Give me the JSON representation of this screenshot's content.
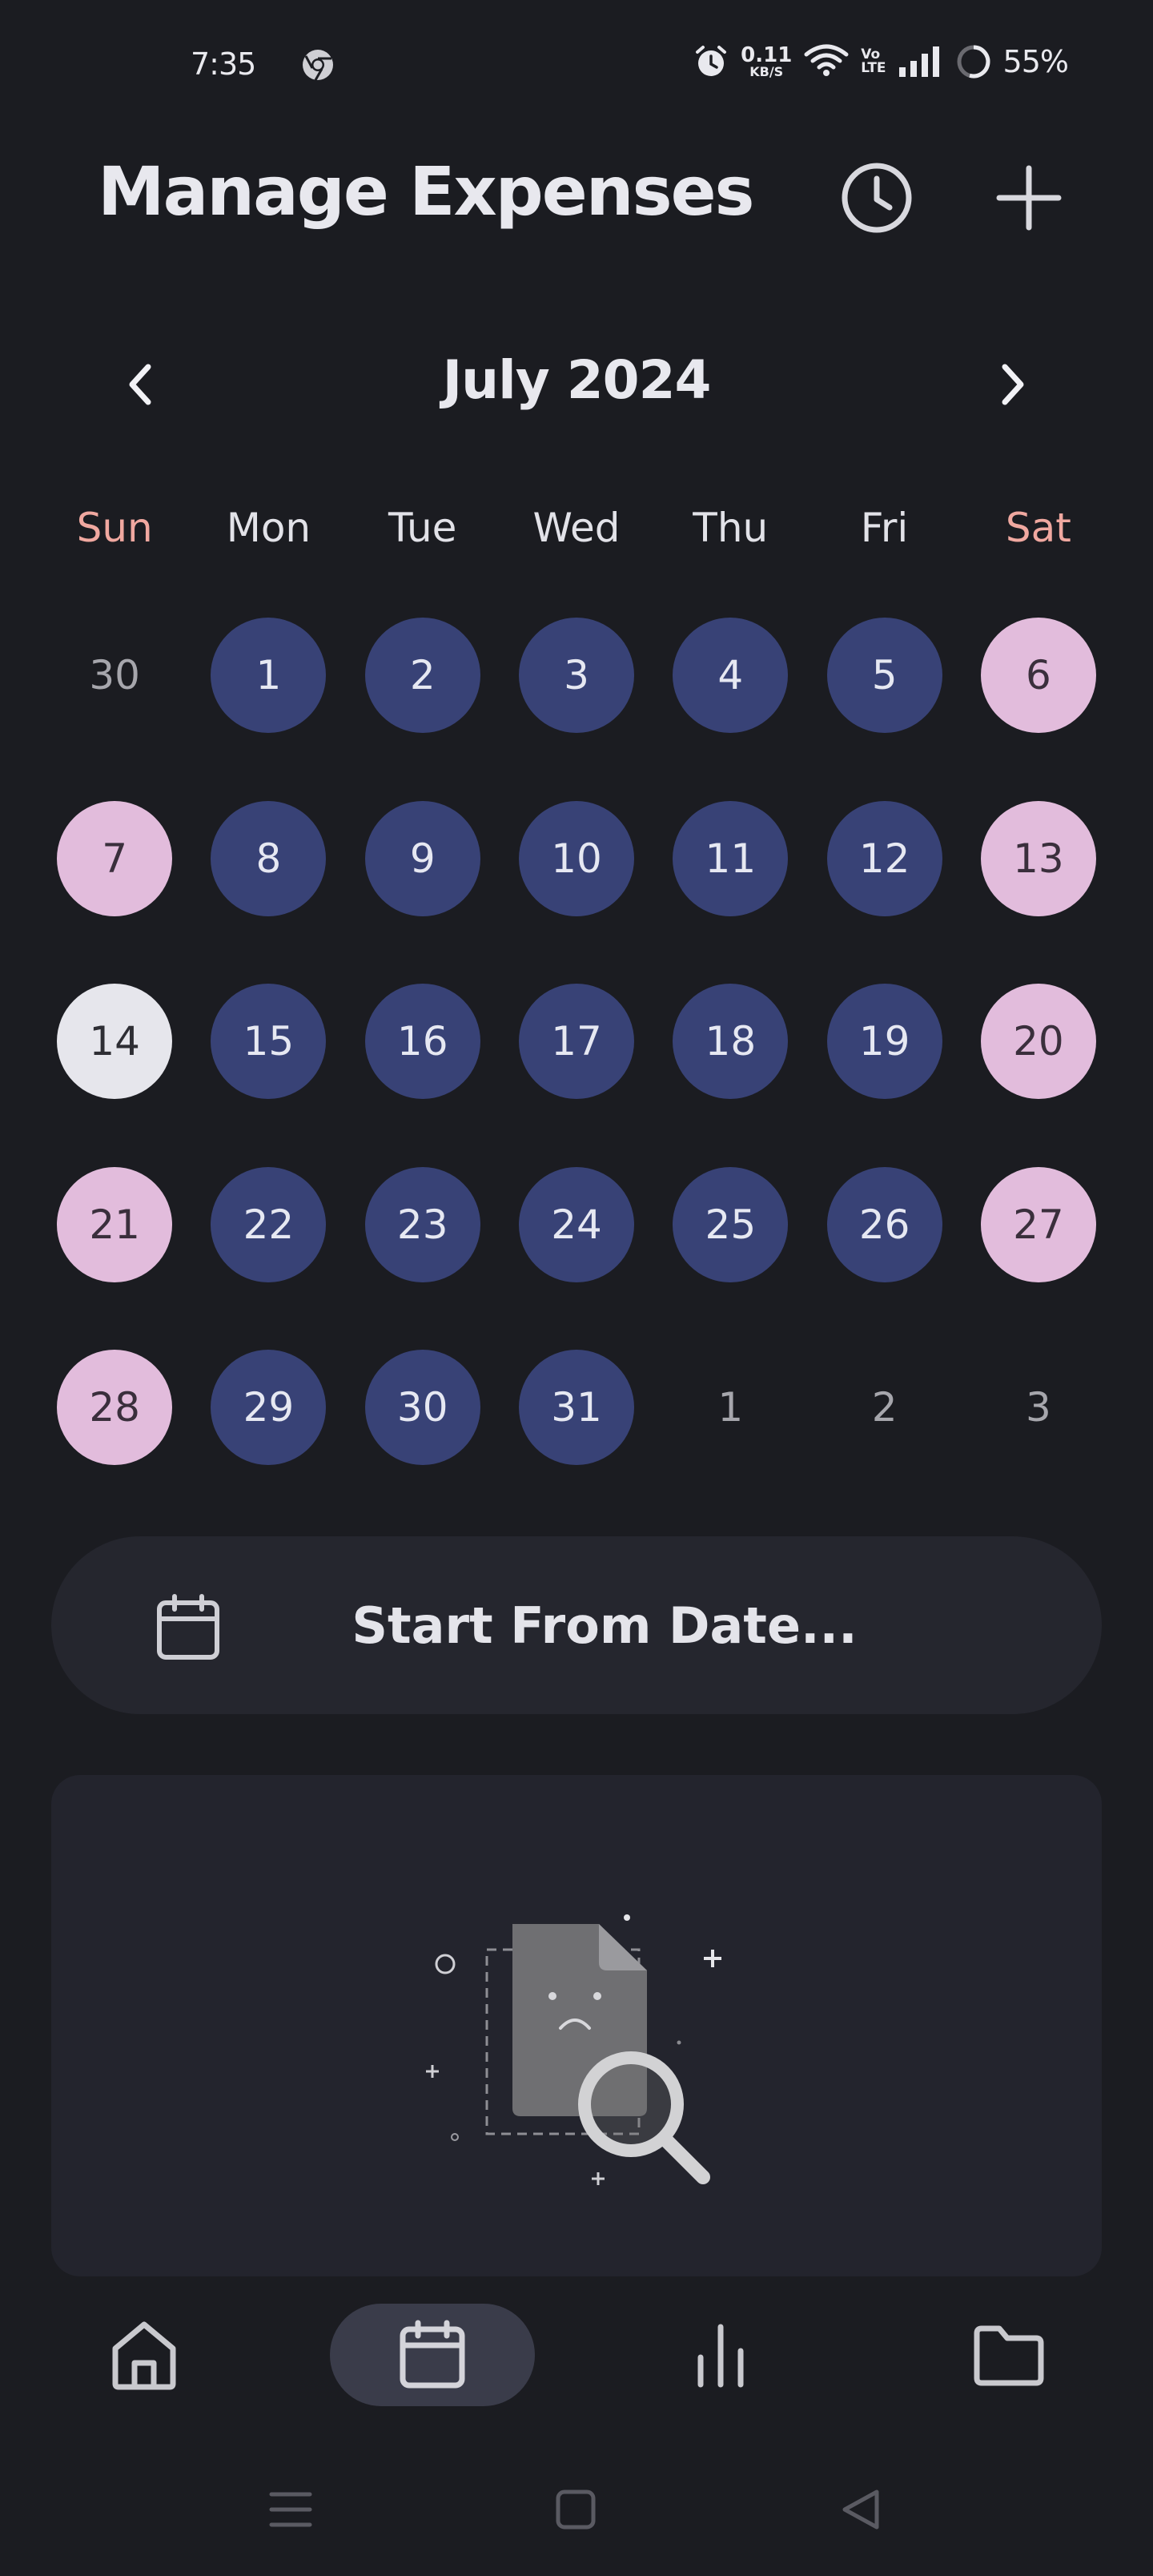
{
  "status_bar": {
    "time": "7:35",
    "net_speed_value": "0.11",
    "net_speed_unit": "KB/S",
    "volte_top": "Vo",
    "volte_bottom": "LTE",
    "battery": "55%"
  },
  "header": {
    "title": "Manage Expenses",
    "history_icon": "clock-icon",
    "add_icon": "plus-icon"
  },
  "calendar": {
    "month_label": "July 2024",
    "weekdays": [
      "Sun",
      "Mon",
      "Tue",
      "Wed",
      "Thu",
      "Fri",
      "Sat"
    ],
    "days": [
      {
        "label": "30",
        "kind": "outside"
      },
      {
        "label": "1",
        "kind": "weekday"
      },
      {
        "label": "2",
        "kind": "weekday"
      },
      {
        "label": "3",
        "kind": "weekday"
      },
      {
        "label": "4",
        "kind": "weekday"
      },
      {
        "label": "5",
        "kind": "weekday"
      },
      {
        "label": "6",
        "kind": "weekend"
      },
      {
        "label": "7",
        "kind": "weekend"
      },
      {
        "label": "8",
        "kind": "weekday"
      },
      {
        "label": "9",
        "kind": "weekday"
      },
      {
        "label": "10",
        "kind": "weekday"
      },
      {
        "label": "11",
        "kind": "weekday"
      },
      {
        "label": "12",
        "kind": "weekday"
      },
      {
        "label": "13",
        "kind": "weekend"
      },
      {
        "label": "14",
        "kind": "today"
      },
      {
        "label": "15",
        "kind": "weekday"
      },
      {
        "label": "16",
        "kind": "weekday"
      },
      {
        "label": "17",
        "kind": "weekday"
      },
      {
        "label": "18",
        "kind": "weekday"
      },
      {
        "label": "19",
        "kind": "weekday"
      },
      {
        "label": "20",
        "kind": "weekend"
      },
      {
        "label": "21",
        "kind": "weekend"
      },
      {
        "label": "22",
        "kind": "weekday"
      },
      {
        "label": "23",
        "kind": "weekday"
      },
      {
        "label": "24",
        "kind": "weekday"
      },
      {
        "label": "25",
        "kind": "weekday"
      },
      {
        "label": "26",
        "kind": "weekday"
      },
      {
        "label": "27",
        "kind": "weekend"
      },
      {
        "label": "28",
        "kind": "weekend"
      },
      {
        "label": "29",
        "kind": "weekday"
      },
      {
        "label": "30",
        "kind": "weekday"
      },
      {
        "label": "31",
        "kind": "weekday"
      },
      {
        "label": "1",
        "kind": "outside"
      },
      {
        "label": "2",
        "kind": "outside"
      },
      {
        "label": "3",
        "kind": "outside"
      }
    ]
  },
  "start_from_date": {
    "label": "Start From Date...",
    "icon": "calendar-icon"
  },
  "empty_state": {
    "illustration": "no-results-document-magnifier"
  },
  "bottom_nav": {
    "items": [
      {
        "name": "home",
        "icon": "home-icon",
        "active": false
      },
      {
        "name": "calendar",
        "icon": "calendar-icon",
        "active": true
      },
      {
        "name": "stats",
        "icon": "bar-chart-icon",
        "active": false
      },
      {
        "name": "folder",
        "icon": "folder-icon",
        "active": false
      }
    ]
  },
  "colors": {
    "background": "#1b1c21",
    "weekday_day": "#384276",
    "weekend_day": "#e2bcdc",
    "today": "#e6e6ec",
    "weekend_label": "#f0a8a0",
    "card": "#23242d"
  }
}
